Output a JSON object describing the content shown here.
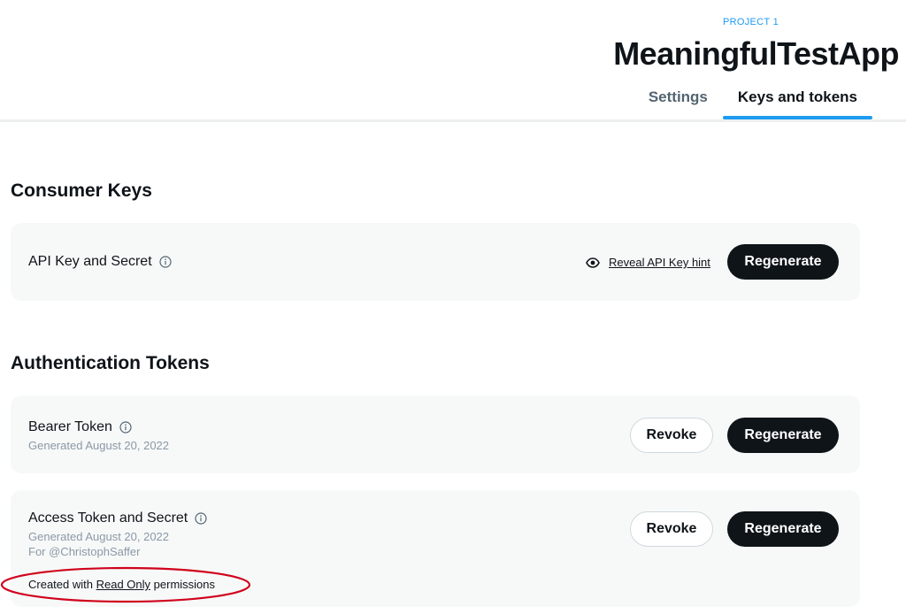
{
  "header": {
    "project_label": "PROJECT 1",
    "app_title": "MeaningfulTestApp",
    "tabs": [
      {
        "label": "Settings",
        "active": false
      },
      {
        "label": "Keys and tokens",
        "active": true
      }
    ]
  },
  "consumer_keys": {
    "title": "Consumer Keys",
    "api_key": {
      "label": "API Key and Secret",
      "reveal_label": "Reveal API Key hint",
      "regenerate_label": "Regenerate"
    }
  },
  "auth_tokens": {
    "title": "Authentication Tokens",
    "bearer": {
      "label": "Bearer Token",
      "generated": "Generated August 20, 2022",
      "revoke_label": "Revoke",
      "regenerate_label": "Regenerate"
    },
    "access": {
      "label": "Access Token and Secret",
      "generated": "Generated August 20, 2022",
      "for_user": "For @ChristophSaffer",
      "perm_prefix": "Created with",
      "perm_link": "Read Only",
      "perm_suffix": "permissions",
      "revoke_label": "Revoke",
      "regenerate_label": "Regenerate"
    }
  },
  "colors": {
    "accent": "#1d9bf0",
    "annotation": "#d0021b",
    "card_bg": "#f7f9f9"
  }
}
